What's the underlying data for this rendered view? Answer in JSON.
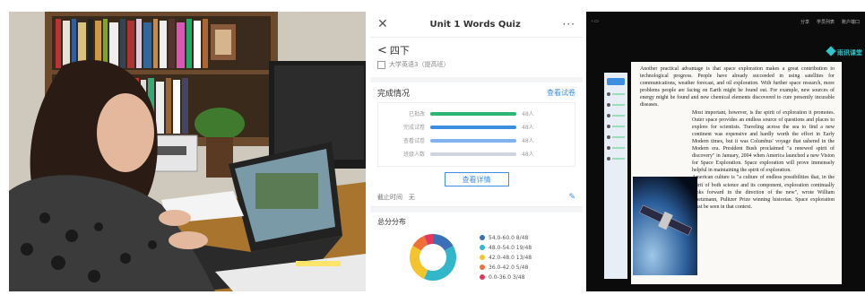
{
  "phone": {
    "header_title": "Unit 1 Words Quiz",
    "close_icon_glyph": "✕",
    "more_glyph": "···",
    "back_label": "四下",
    "class_name": "大学英语3（提高班）",
    "completion": {
      "title": "完成情况",
      "link": "查看试卷",
      "rows": [
        {
          "label": "已批改",
          "count": "48人",
          "color": "#2bb673",
          "fraction": 1.0
        },
        {
          "label": "完成试卷",
          "count": "48人",
          "color": "#3b8ee0",
          "fraction": 1.0
        },
        {
          "label": "查看试卷",
          "count": "48人",
          "color": "#7fb2ee",
          "fraction": 1.0
        },
        {
          "label": "班级人数",
          "count": "48人",
          "color": "#cfd6df",
          "fraction": 1.0
        }
      ],
      "detail_button": "查看详情"
    },
    "deadline": {
      "label": "截止时间",
      "value": "无"
    },
    "score_distribution": {
      "title": "总分分布"
    }
  },
  "chart_data": {
    "type": "pie",
    "categories": [
      "54.0-60.0",
      "48.0-54.0",
      "42.0-48.0",
      "36.0-42.0",
      "0.0-36.0"
    ],
    "values": [
      8,
      19,
      13,
      5,
      3
    ],
    "labels": [
      "54.0-60.0  8/48",
      "48.0-54.0  19/48",
      "42.0-48.0  13/48",
      "36.0-42.0  5/48",
      "0.0-36.0  3/48"
    ],
    "colors": [
      "#3b6fb6",
      "#31b7c9",
      "#f5c32c",
      "#f0703a",
      "#e6365b"
    ],
    "total": 48
  },
  "screen": {
    "top_right_items": [
      "分享",
      "学员列表",
      "账户端口"
    ],
    "brand": "雨讯课堂",
    "paragraphs": [
      "Another practical advantage is that space exploration makes a great contribution to technological progress. People have already succeeded in using satellites for communications, weather forecast, and oil exploration. With further space research, more problems people are facing on Earth might be found out. For example, new sources of energy might be found and new chemical elements discovered to cure presently incurable diseases.",
      "Most important, however, is the spirit of exploration it promotes. Outer space provides an endless source of questions and places to explore for scientists. Traveling across the sea to find a new continent was expensive and hardly worth the effort in Early Modern times, but it was Columbus' voyage that ushered in the Modern era. President Bush proclaimed \"a renewed spirit of discovery\" in January, 2004 when America launched a new Vision for Space Exploration. Space exploration will prove immensely helpful in maintaining the spirit of exploration.",
      "American culture is \"a culture of endless possibilities that, in the spirit of both science and its component, exploration continually looks forward in the direction of the new\", wrote William Goetzmann, Pulitzer Prize winning historian. Space exploration must be seen in that context."
    ]
  }
}
